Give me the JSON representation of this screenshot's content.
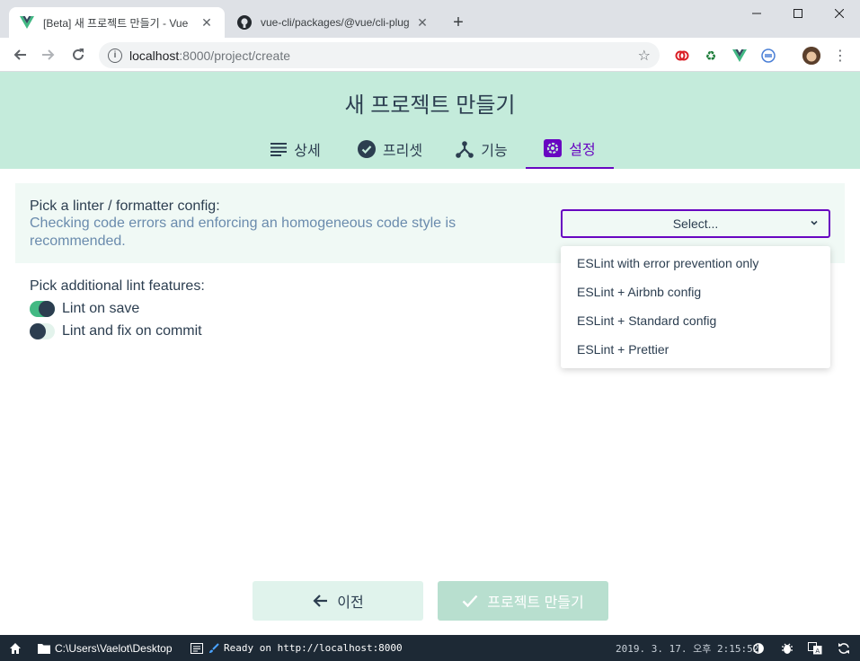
{
  "browser": {
    "tabs": [
      {
        "title": "[Beta] 새 프로젝트 만들기 - Vue",
        "favicon": "vue-logo-icon",
        "active": true
      },
      {
        "title": "vue-cli/packages/@vue/cli-plug",
        "favicon": "github-icon",
        "active": false
      }
    ],
    "new_tab": "+",
    "window_controls": [
      "minimize-icon",
      "maximize-icon",
      "close-icon"
    ],
    "url_host": "localhost",
    "url_rest": ":8000/project/create",
    "extensions": [
      "creative-cloud-icon",
      "recycle-icon",
      "vue-devtools-icon",
      "sync-icon",
      "avatar"
    ]
  },
  "page": {
    "title": "새 프로젝트 만들기",
    "steps": [
      {
        "label": "상세",
        "icon": "list-icon",
        "active": false
      },
      {
        "label": "프리셋",
        "icon": "check-circle-icon",
        "active": false
      },
      {
        "label": "기능",
        "icon": "fork-icon",
        "active": false
      },
      {
        "label": "설정",
        "icon": "settings-icon",
        "active": true
      }
    ]
  },
  "linter": {
    "title": "Pick a linter / formatter config:",
    "description": "Checking code errors and enforcing an homogeneous code style is recommended.",
    "select_placeholder": "Select...",
    "options": [
      "ESLint with error prevention only",
      "ESLint + Airbnb config",
      "ESLint + Standard config",
      "ESLint + Prettier"
    ]
  },
  "features": {
    "title": "Pick additional lint features:",
    "items": [
      {
        "label": "Lint on save",
        "enabled": true
      },
      {
        "label": "Lint and fix on commit",
        "enabled": false
      }
    ]
  },
  "buttons": {
    "previous": "이전",
    "create": "프로젝트 만들기"
  },
  "statusbar": {
    "cwd": "C:\\Users\\Vaelot\\Desktop",
    "log": "Ready on http://localhost:8000",
    "datetime": "2019. 3. 17. 오후 2:15:52"
  },
  "colors": {
    "accent": "#6806c1",
    "header_bg": "#c4ebdb",
    "toggle_on": "#42b983",
    "text": "#2c3e50",
    "statusbar_bg": "#1d2935"
  }
}
